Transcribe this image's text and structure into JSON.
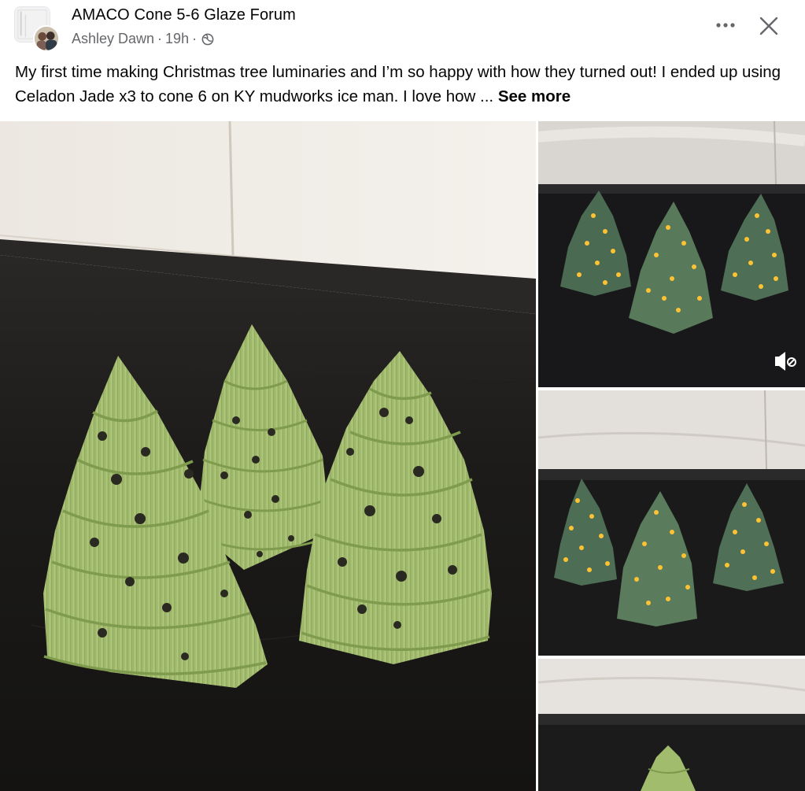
{
  "post": {
    "group_name": "AMACO Cone 5-6 Glaze Forum",
    "author": "Ashley Dawn",
    "separator": "·",
    "timestamp": "19h",
    "audience_icon": "globe-icon",
    "text": "My first time making Christmas tree luminaries and I’m so happy with how they turned out! I ended up using Celadon Jade x3 to cone 6 on KY mudworks ice man. I love how ...",
    "see_more_label": "See more"
  },
  "header_actions": {
    "more_icon": "more-horizontal-icon",
    "close_icon": "close-icon"
  },
  "media": {
    "mute_icon": "volume-muted-icon"
  },
  "colors": {
    "glaze_green": "#9fb86a",
    "lit_glaze": "#4f7157",
    "glow": "#ffc233",
    "countertop": "#1c1b1a",
    "tile": "#e8e3dc"
  }
}
